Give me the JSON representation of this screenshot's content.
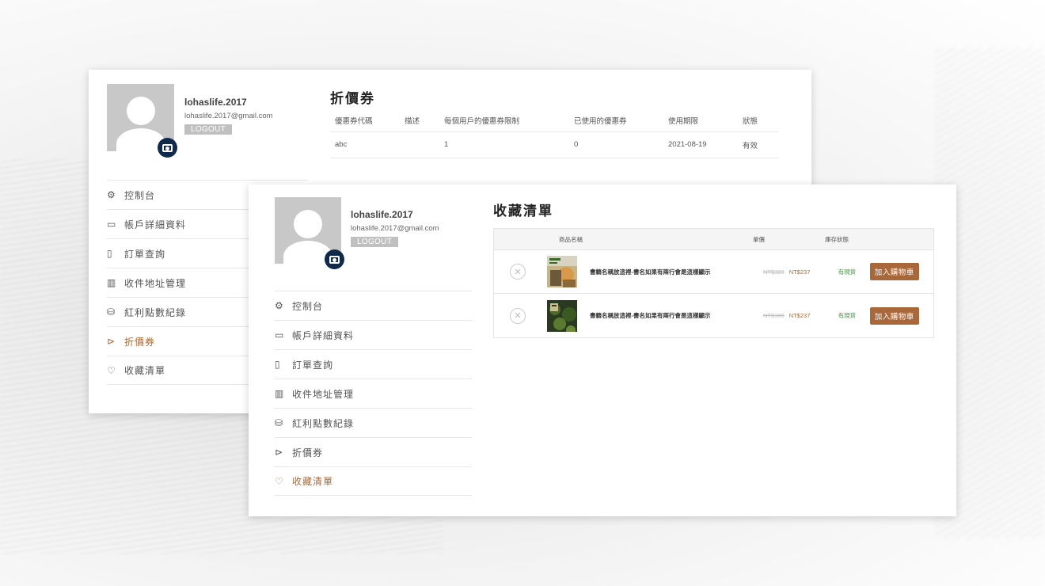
{
  "user": {
    "name": "lohaslife.2017",
    "email": "lohaslife.2017@gmail.com",
    "logout_label": "LOGOUT"
  },
  "menu": [
    {
      "icon": "gear-icon",
      "glyph": "⚙",
      "label": "控制台"
    },
    {
      "icon": "id-card-icon",
      "glyph": "▭",
      "label": "帳戶詳細資料"
    },
    {
      "icon": "file-icon",
      "glyph": "▯",
      "label": "訂單查詢"
    },
    {
      "icon": "map-icon",
      "glyph": "▥",
      "label": "收件地址管理"
    },
    {
      "icon": "database-icon",
      "glyph": "⛁",
      "label": "紅利點數紀錄"
    },
    {
      "icon": "tag-icon",
      "glyph": "⊳",
      "label": "折價券"
    },
    {
      "icon": "heart-icon",
      "glyph": "♡",
      "label": "收藏清單"
    }
  ],
  "coupons": {
    "title": "折價券",
    "headers": [
      "優惠券代碼",
      "描述",
      "每個用戶的優惠券限制",
      "已使用的優惠券",
      "使用期限",
      "狀態"
    ],
    "rows": [
      [
        "abc",
        "",
        "1",
        "0",
        "2021-08-19",
        "有效"
      ]
    ]
  },
  "wishlist": {
    "title": "收藏清單",
    "headers": {
      "name": "商品名稱",
      "price": "單價",
      "stock": "庫存狀態"
    },
    "items": [
      {
        "remove": "✕",
        "name": "書籍名稱放這裡-書名如果有兩行會是這樣顯示",
        "old_price": "NT$300",
        "price": "NT$237",
        "stock": "有現貨",
        "cart_label": "加入購物車"
      },
      {
        "remove": "✕",
        "name": "書籍名稱放這裡-書名如果有兩行會是這樣顯示",
        "old_price": "NT$300",
        "price": "NT$237",
        "stock": "有現貨",
        "cart_label": "加入購物車"
      }
    ]
  },
  "colors": {
    "accent": "#a8683a",
    "camera": "#0f2a4a",
    "stock": "#4a9a4a"
  }
}
